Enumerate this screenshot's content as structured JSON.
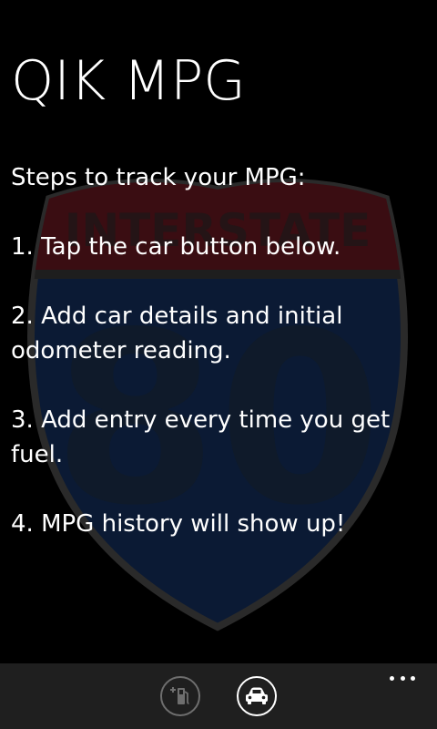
{
  "app": {
    "title": "QIK MPG"
  },
  "background": {
    "shield_text_top": "INTERSTATE",
    "shield_number": "80",
    "colors": {
      "shield_red": "#3a0d12",
      "shield_blue": "#0b1a34",
      "shield_outline": "#2a2a2a"
    }
  },
  "steps": {
    "heading": "Steps to track your MPG:",
    "items": [
      "1. Tap the car button below.",
      "2. Add car details and initial odometer reading.",
      "3. Add entry every time you get fuel.",
      "4. MPG history will show up!"
    ]
  },
  "appbar": {
    "buttons": [
      {
        "icon": "fuel-pump-add-icon",
        "state": "disabled"
      },
      {
        "icon": "car-icon",
        "state": "enabled"
      }
    ],
    "more_icon": "ellipsis-icon",
    "background_color": "#1f1f1f"
  }
}
